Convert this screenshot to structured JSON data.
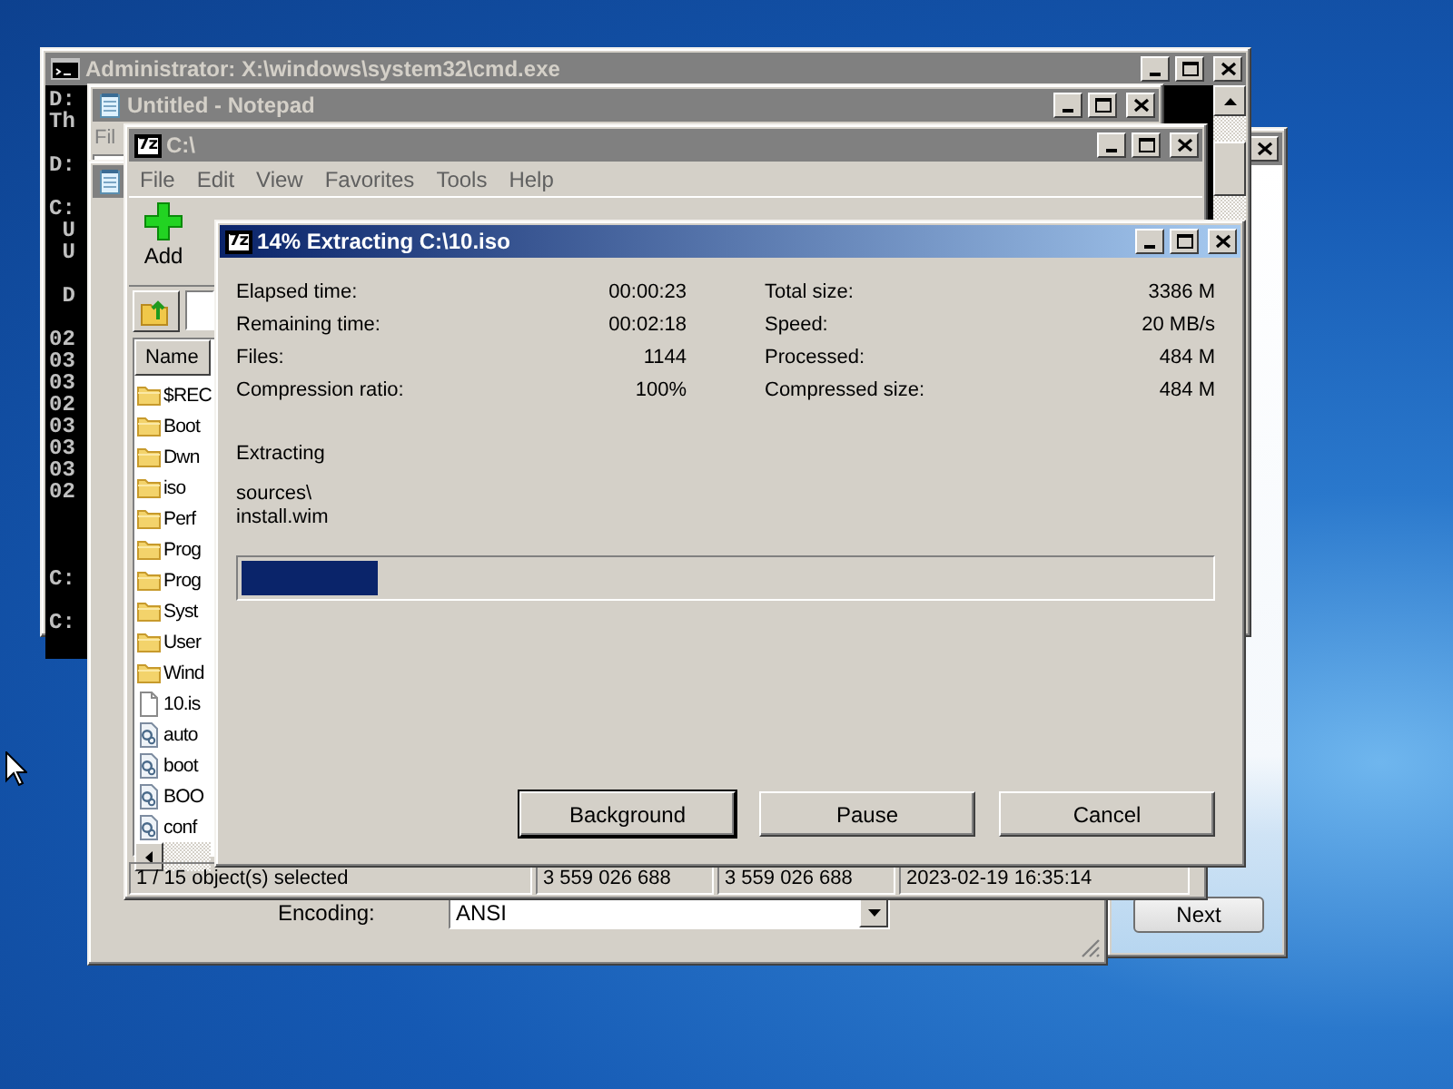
{
  "cmd_window": {
    "active": false,
    "title": "Administrator: X:\\windows\\system32\\cmd.exe",
    "console_blocks": [
      [
        "D:",
        "Th"
      ],
      [
        "D:"
      ],
      [
        "C:",
        " U",
        " U"
      ],
      [
        " D"
      ],
      [
        "02",
        "03",
        "03",
        "02",
        "03",
        "03",
        "03",
        "02"
      ],
      [
        "C:"
      ],
      [
        "C:"
      ]
    ]
  },
  "notepad_window": {
    "active": false,
    "title": "Untitled - Notepad",
    "menu": [
      "Fil"
    ]
  },
  "save_dialog": {
    "active": false,
    "encoding_label": "Encoding:",
    "encoding_value": "ANSI"
  },
  "setup_window": {
    "active": false,
    "next_button": "Next"
  },
  "file_manager": {
    "active": false,
    "icon_label": "7z",
    "title": "C:\\",
    "menu": [
      "File",
      "Edit",
      "View",
      "Favorites",
      "Tools",
      "Help"
    ],
    "toolbar": [
      {
        "label": "Add"
      }
    ],
    "column_header": "Name",
    "files": [
      {
        "name": "$REC",
        "kind": "folder"
      },
      {
        "name": "Boot",
        "kind": "folder"
      },
      {
        "name": "Dwn",
        "kind": "folder"
      },
      {
        "name": "iso",
        "kind": "folder"
      },
      {
        "name": "Perf",
        "kind": "folder"
      },
      {
        "name": "Prog",
        "kind": "folder"
      },
      {
        "name": "Prog",
        "kind": "folder"
      },
      {
        "name": "Syst",
        "kind": "folder"
      },
      {
        "name": "User",
        "kind": "folder"
      },
      {
        "name": "Wind",
        "kind": "folder"
      },
      {
        "name": "10.is",
        "kind": "file"
      },
      {
        "name": "auto",
        "kind": "config"
      },
      {
        "name": "boot",
        "kind": "config"
      },
      {
        "name": "BOO",
        "kind": "config"
      },
      {
        "name": "conf",
        "kind": "config"
      }
    ],
    "status_bar": [
      "1 / 15 object(s) selected",
      "3 559 026 688",
      "3 559 026 688",
      "2023-02-19 16:35:14"
    ]
  },
  "progress_dialog": {
    "active": true,
    "icon_label": "7z",
    "title": "14% Extracting C:\\10.iso",
    "stats_left": [
      {
        "label": "Elapsed time:",
        "value": "00:00:23"
      },
      {
        "label": "Remaining time:",
        "value": "00:02:18"
      },
      {
        "label": "Files:",
        "value": "1144"
      },
      {
        "label": "Compression ratio:",
        "value": "100%"
      }
    ],
    "stats_right": [
      {
        "label": "Total size:",
        "value": "3386 M"
      },
      {
        "label": "Speed:",
        "value": "20 MB/s"
      },
      {
        "label": "Processed:",
        "value": "484 M"
      },
      {
        "label": "Compressed size:",
        "value": "484 M"
      }
    ],
    "status": "Extracting",
    "current_folder": "sources\\",
    "current_file": "install.wim",
    "progress": {
      "level": 0.14
    },
    "buttons": [
      {
        "label": "Background",
        "default": true
      },
      {
        "label": "Pause",
        "default": false
      },
      {
        "label": "Cancel",
        "default": false
      }
    ]
  }
}
